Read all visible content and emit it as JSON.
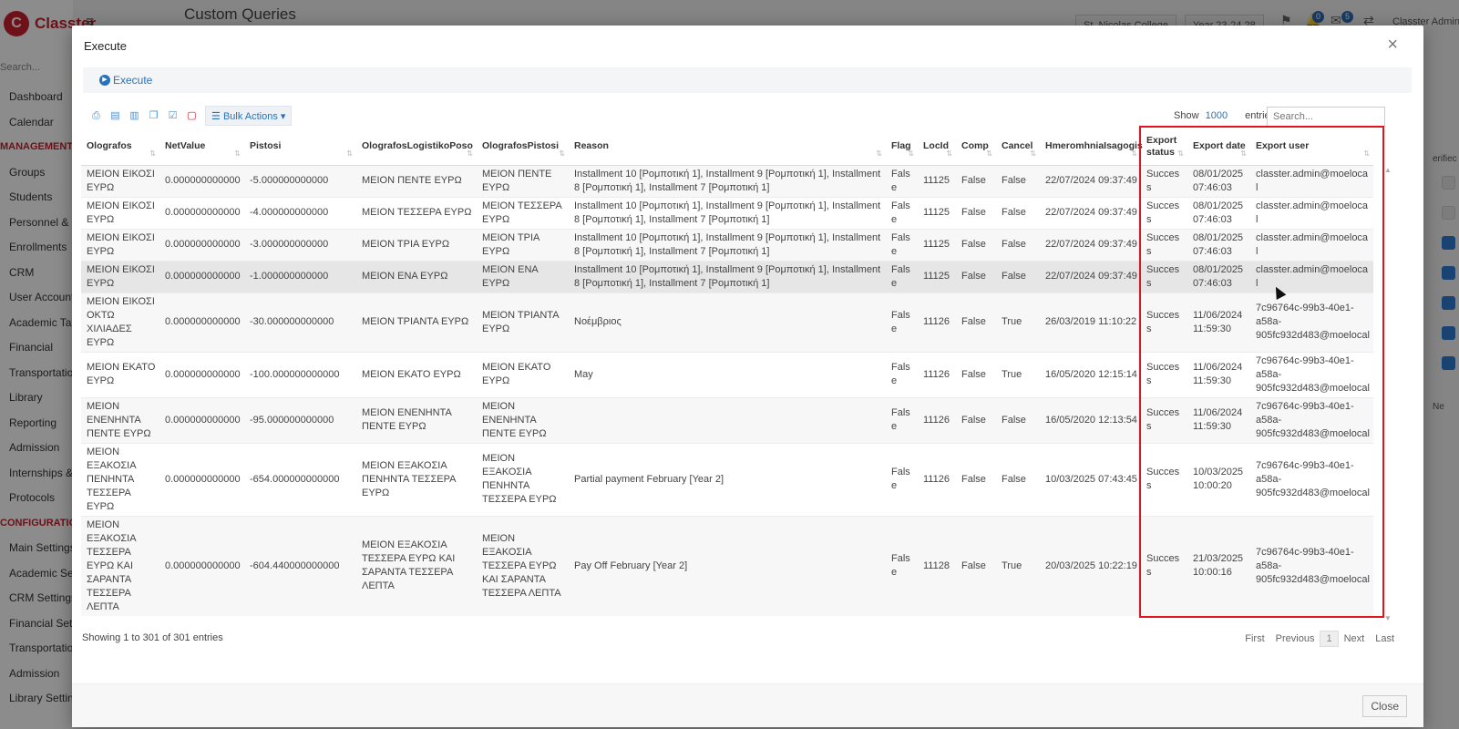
{
  "app": {
    "logo_mark": "C",
    "logo_text": "Classter",
    "page_title": "Custom Queries",
    "search_placeholder": "Search...",
    "school": "St. Nicolas College",
    "year": "Year 23-24 28",
    "notif_count_1": "0",
    "notif_count_2": "5",
    "user": "Classter Admin"
  },
  "sidebar": {
    "items": [
      {
        "label": "Dashboard",
        "section": false
      },
      {
        "label": "Calendar",
        "section": false
      },
      {
        "label": "MANAGEMENT",
        "section": true
      },
      {
        "label": "Groups",
        "section": false
      },
      {
        "label": "Students",
        "section": false
      },
      {
        "label": "Personnel & C",
        "section": false
      },
      {
        "label": "Enrollments",
        "section": false
      },
      {
        "label": "CRM",
        "section": false
      },
      {
        "label": "User Accounts",
        "section": false
      },
      {
        "label": "Academic Tas",
        "section": false
      },
      {
        "label": "Financial",
        "section": false
      },
      {
        "label": "Transportatio",
        "section": false
      },
      {
        "label": "Library",
        "section": false
      },
      {
        "label": "Reporting",
        "section": false
      },
      {
        "label": "Admission",
        "section": false
      },
      {
        "label": "Internships &",
        "section": false
      },
      {
        "label": "Protocols",
        "section": false
      },
      {
        "label": "CONFIGURATION",
        "section": true
      },
      {
        "label": "Main Settings",
        "section": false
      },
      {
        "label": "Academic Set",
        "section": false
      },
      {
        "label": "CRM Settings",
        "section": false
      },
      {
        "label": "Financial Setti",
        "section": false
      },
      {
        "label": "Transportatio",
        "section": false
      },
      {
        "label": "Admission",
        "section": false
      },
      {
        "label": "Library Setting",
        "section": false
      }
    ]
  },
  "right_peek": {
    "header": "erifiec",
    "footer": "Ne"
  },
  "modal": {
    "title": "Execute",
    "close_x": "×",
    "execute_label": "Execute",
    "bulk_actions_label": "Bulk Actions",
    "show_label": "Show",
    "show_count": "1000",
    "entries_label": "entries",
    "search_placeholder": "Search...",
    "info": "Showing 1 to 301 of 301 entries",
    "paging": {
      "first": "First",
      "previous": "Previous",
      "current": "1",
      "next": "Next",
      "last": "Last"
    },
    "close_label": "Close"
  },
  "table": {
    "columns": [
      "Olografos",
      "NetValue",
      "Pistosi",
      "OlografosLogistikoPoso",
      "OlografosPistosi",
      "Reason",
      "Flag",
      "LocId",
      "Comp",
      "Cancel",
      "HmeromhniaIsagogis",
      "Export status",
      "Export date",
      "Export user"
    ],
    "rows": [
      [
        "ΜΕΙΟΝ ΕΙΚΟΣΙ ΕΥΡΩ",
        "0.000000000000",
        "-5.000000000000",
        "ΜΕΙΟΝ ΠΕΝΤΕ ΕΥΡΩ",
        "ΜΕΙΟΝ ΠΕΝΤΕ ΕΥΡΩ",
        "Installment 10 [Ρομποτική 1], Installment 9 [Ρομποτική 1], Installment 8 [Ρομποτική 1], Installment 7 [Ρομποτική 1]",
        "False",
        "11125",
        "False",
        "False",
        "22/07/2024 09:37:49",
        "Success",
        "08/01/2025 07:46:03",
        "classter.admin@moelocal"
      ],
      [
        "ΜΕΙΟΝ ΕΙΚΟΣΙ ΕΥΡΩ",
        "0.000000000000",
        "-4.000000000000",
        "ΜΕΙΟΝ ΤΕΣΣΕΡΑ ΕΥΡΩ",
        "ΜΕΙΟΝ ΤΕΣΣΕΡΑ ΕΥΡΩ",
        "Installment 10 [Ρομποτική 1], Installment 9 [Ρομποτική 1], Installment 8 [Ρομποτική 1], Installment 7 [Ρομποτική 1]",
        "False",
        "11125",
        "False",
        "False",
        "22/07/2024 09:37:49",
        "Success",
        "08/01/2025 07:46:03",
        "classter.admin@moelocal"
      ],
      [
        "ΜΕΙΟΝ ΕΙΚΟΣΙ ΕΥΡΩ",
        "0.000000000000",
        "-3.000000000000",
        "ΜΕΙΟΝ ΤΡΙΑ ΕΥΡΩ",
        "ΜΕΙΟΝ ΤΡΙΑ ΕΥΡΩ",
        "Installment 10 [Ρομποτική 1], Installment 9 [Ρομποτική 1], Installment 8 [Ρομποτική 1], Installment 7 [Ρομποτική 1]",
        "False",
        "11125",
        "False",
        "False",
        "22/07/2024 09:37:49",
        "Success",
        "08/01/2025 07:46:03",
        "classter.admin@moelocal"
      ],
      [
        "ΜΕΙΟΝ ΕΙΚΟΣΙ ΕΥΡΩ",
        "0.000000000000",
        "-1.000000000000",
        "ΜΕΙΟΝ ΕΝΑ ΕΥΡΩ",
        "ΜΕΙΟΝ ΕΝΑ ΕΥΡΩ",
        "Installment 10 [Ρομποτική 1], Installment 9 [Ρομποτική 1], Installment 8 [Ρομποτική 1], Installment 7 [Ρομποτική 1]",
        "False",
        "11125",
        "False",
        "False",
        "22/07/2024 09:37:49",
        "Success",
        "08/01/2025 07:46:03",
        "classter.admin@moelocal"
      ],
      [
        "ΜΕΙΟΝ ΕΙΚΟΣΙ ΟΚΤΩ ΧΙΛΙΑΔΕΣ ΕΥΡΩ",
        "0.000000000000",
        "-30.000000000000",
        "ΜΕΙΟΝ ΤΡΙΑΝΤΑ ΕΥΡΩ",
        "ΜΕΙΟΝ ΤΡΙΑΝΤΑ ΕΥΡΩ",
        "Νοέμβριος",
        "False",
        "11126",
        "False",
        "True",
        "26/03/2019 11:10:22",
        "Success",
        "11/06/2024 11:59:30",
        "7c96764c-99b3-40e1-a58a-905fc932d483@moelocal"
      ],
      [
        "ΜΕΙΟΝ ΕΚΑΤΟ ΕΥΡΩ",
        "0.000000000000",
        "-100.000000000000",
        "ΜΕΙΟΝ ΕΚΑΤΟ ΕΥΡΩ",
        "ΜΕΙΟΝ ΕΚΑΤΟ ΕΥΡΩ",
        "May",
        "False",
        "11126",
        "False",
        "True",
        "16/05/2020 12:15:14",
        "Success",
        "11/06/2024 11:59:30",
        "7c96764c-99b3-40e1-a58a-905fc932d483@moelocal"
      ],
      [
        "ΜΕΙΟΝ ΕΝΕΝΗΝΤΑ ΠΕΝΤΕ ΕΥΡΩ",
        "0.000000000000",
        "-95.000000000000",
        "ΜΕΙΟΝ ΕΝΕΝΗΝΤΑ ΠΕΝΤΕ ΕΥΡΩ",
        "ΜΕΙΟΝ ΕΝΕΝΗΝΤΑ ΠΕΝΤΕ ΕΥΡΩ",
        "",
        "False",
        "11126",
        "False",
        "False",
        "16/05/2020 12:13:54",
        "Success",
        "11/06/2024 11:59:30",
        "7c96764c-99b3-40e1-a58a-905fc932d483@moelocal"
      ],
      [
        "ΜΕΙΟΝ ΕΞΑΚΟΣΙΑ ΠΕΝΗΝΤΑ ΤΕΣΣΕΡΑ ΕΥΡΩ",
        "0.000000000000",
        "-654.000000000000",
        "ΜΕΙΟΝ ΕΞΑΚΟΣΙΑ ΠΕΝΗΝΤΑ ΤΕΣΣΕΡΑ ΕΥΡΩ",
        "ΜΕΙΟΝ ΕΞΑΚΟΣΙΑ ΠΕΝΗΝΤΑ ΤΕΣΣΕΡΑ ΕΥΡΩ",
        "Partial payment February [Year 2]",
        "False",
        "11126",
        "False",
        "False",
        "10/03/2025 07:43:45",
        "Success",
        "10/03/2025 10:00:20",
        "7c96764c-99b3-40e1-a58a-905fc932d483@moelocal"
      ],
      [
        "ΜΕΙΟΝ ΕΞΑΚΟΣΙΑ ΤΕΣΣΕΡΑ ΕΥΡΩ ΚΑΙ ΣΑΡΑΝΤΑ ΤΕΣΣΕΡΑ ΛΕΠΤΑ",
        "0.000000000000",
        "-604.440000000000",
        "ΜΕΙΟΝ ΕΞΑΚΟΣΙΑ ΤΕΣΣΕΡΑ ΕΥΡΩ ΚΑΙ ΣΑΡΑΝΤΑ ΤΕΣΣΕΡΑ ΛΕΠΤΑ",
        "ΜΕΙΟΝ ΕΞΑΚΟΣΙΑ ΤΕΣΣΕΡΑ ΕΥΡΩ ΚΑΙ ΣΑΡΑΝΤΑ ΤΕΣΣΕΡΑ ΛΕΠΤΑ",
        "Pay Off February [Year 2]",
        "False",
        "11128",
        "False",
        "True",
        "20/03/2025 10:22:19",
        "Success",
        "21/03/2025 10:00:16",
        "7c96764c-99b3-40e1-a58a-905fc932d483@moelocal"
      ]
    ],
    "hovered_row": 3
  }
}
